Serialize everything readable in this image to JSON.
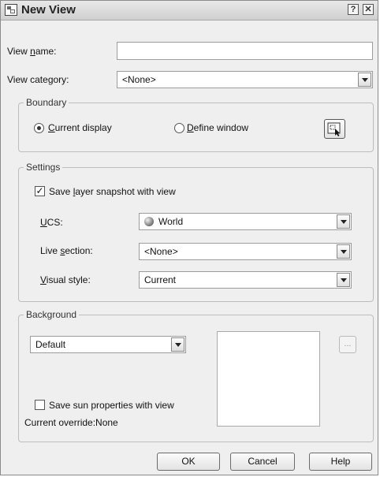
{
  "window": {
    "title": "New View",
    "help_glyph": "?",
    "close_glyph": "✕"
  },
  "view_name": {
    "label_pre": "View ",
    "label_u": "n",
    "label_post": "ame:",
    "value": ""
  },
  "view_category": {
    "label_pre": "View cate",
    "label_u": "g",
    "label_post": "ory:",
    "value": "<None>"
  },
  "boundary": {
    "title": "Boundary",
    "current_display": {
      "u": "C",
      "rest": "urrent display",
      "selected": true
    },
    "define_window": {
      "u": "D",
      "rest": "efine window",
      "selected": false
    }
  },
  "settings": {
    "title": "Settings",
    "save_layer": {
      "pre": "Save ",
      "u": "l",
      "post": "ayer snapshot with view",
      "checked": true
    },
    "ucs": {
      "label_u": "U",
      "label_post": "CS:",
      "value": "World"
    },
    "live_section": {
      "label_pre": "Live ",
      "label_u": "s",
      "label_post": "ection:",
      "value": "<None>"
    },
    "visual_style": {
      "label_u": "V",
      "label_post": "isual style:",
      "value": "Current"
    }
  },
  "background": {
    "title": "Background",
    "value": "Default",
    "ellipsis_label": "...",
    "save_sun": {
      "label": "Save sun properties with view",
      "checked": false
    },
    "override_text": "Current override:None"
  },
  "buttons": {
    "ok": "OK",
    "cancel": "Cancel",
    "help": "Help"
  }
}
